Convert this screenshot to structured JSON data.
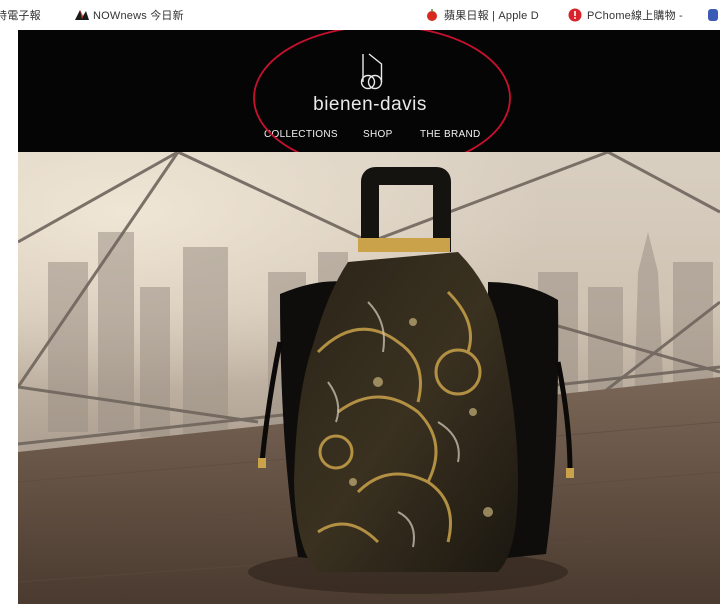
{
  "bookmarks": [
    {
      "label": "時電子報",
      "icon": "news-icon"
    },
    {
      "label": "NOWnews 今日新",
      "icon": "nownews-logo-icon"
    },
    {
      "label": "蘋果日報 | Apple D",
      "icon": "apple-daily-icon"
    },
    {
      "label": "PChome線上購物 -",
      "icon": "pchome-icon"
    }
  ],
  "site": {
    "brand": "bienen-davis",
    "logo_icon": "bienen-davis-monogram-icon",
    "nav": [
      "COLLECTIONS",
      "SHOP",
      "THE BRAND"
    ]
  },
  "hero": {
    "image": "brocade-bucket-bag-photo"
  },
  "colors": {
    "header_bg": "#050505",
    "annotation": "#c8102e",
    "gold": "#c9a24a"
  }
}
